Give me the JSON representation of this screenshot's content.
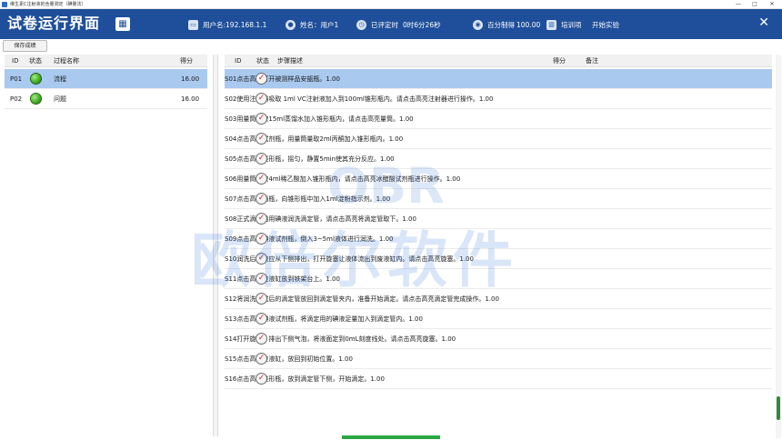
{
  "window": {
    "title": "维生素C注射液的含量测定（碘量法）",
    "controls": [
      "—",
      "□",
      "✕"
    ]
  },
  "header": {
    "app_title": "试卷运行界面",
    "username_label": "用户名:192.168.1.1",
    "name_label": "姓名：用户1",
    "timer_label": "已评定时",
    "timer_value": "0时6分26秒",
    "score_label": "百分制得",
    "score_value": "100.00",
    "mode_label": "培训项",
    "start_label": "开始实验",
    "close_icon": "✕"
  },
  "toolbar": {
    "save_label": "保存成绩"
  },
  "left_table": {
    "columns": [
      "ID",
      "状态",
      "过程名称",
      "得分"
    ],
    "rows": [
      {
        "id": "P01",
        "name": "流程",
        "score": "16.00",
        "selected": true
      },
      {
        "id": "P02",
        "name": "问题",
        "score": "16.00",
        "selected": false
      }
    ]
  },
  "right_table": {
    "columns": [
      "ID",
      "状态",
      "步骤描述",
      "得分",
      "备注"
    ],
    "rows": [
      {
        "id": "S01",
        "desc": "点击高亮打开被测样品安瓿瓶。",
        "score": "1.00",
        "note": "",
        "selected": true
      },
      {
        "id": "S02",
        "desc": "使用注射器吸取 1ml VC注射液加入到100ml锥形瓶内。请点击高亮注射器进行操作。",
        "score": "1.00",
        "note": ""
      },
      {
        "id": "S03",
        "desc": "用量筒量取15ml蒸馏水加入锥形瓶内，请点击高亮量筒。",
        "score": "1.00",
        "note": ""
      },
      {
        "id": "S04",
        "desc": "点击高亮试剂瓶，用量筒量取2ml丙酮加入锥形瓶内。",
        "score": "1.00",
        "note": ""
      },
      {
        "id": "S05",
        "desc": "点击高亮锥形瓶，摇匀，静置5min使其充分反应。",
        "score": "1.00",
        "note": ""
      },
      {
        "id": "S06",
        "desc": "用量筒量取4ml稀乙酸加入锥形瓶内，请点击高亮冰醋酸试剂瓶进行操作。",
        "score": "1.00",
        "note": ""
      },
      {
        "id": "S07",
        "desc": "点击高亮滴瓶，向锥形瓶中加入1ml淀粉指示剂。",
        "score": "1.00",
        "note": ""
      },
      {
        "id": "S08",
        "desc": "正式滴定前用碘液润洗滴定管，请点击高亮将滴定管取下。",
        "score": "1.00",
        "note": ""
      },
      {
        "id": "S09",
        "desc": "点击高亮碘液试剂瓶，倒入3~5ml液体进行润洗。",
        "score": "1.00",
        "note": ""
      },
      {
        "id": "S10",
        "desc": "润洗后碘液应从下侧排出，打开旋塞让液体流出到废液缸内。请点击高亮旋塞。",
        "score": "1.00",
        "note": ""
      },
      {
        "id": "S11",
        "desc": "点击高亮废液缸放到铁架台上。",
        "score": "1.00",
        "note": ""
      },
      {
        "id": "S12",
        "desc": "将润洗完成后的滴定管放回到滴定管夹内，准备开始滴定。请点击高亮滴定管完成操作。",
        "score": "1.00",
        "note": ""
      },
      {
        "id": "S13",
        "desc": "点击高亮碘液试剂瓶，将滴定用的碘液足量加入到滴定管内。",
        "score": "1.00",
        "note": ""
      },
      {
        "id": "S14",
        "desc": "打开旋塞，排出下侧气泡，将液面定到0mL刻度线处。请点击高亮旋塞。",
        "score": "1.00",
        "note": ""
      },
      {
        "id": "S15",
        "desc": "点击高亮废液缸，放回到初始位置。",
        "score": "1.00",
        "note": ""
      },
      {
        "id": "S16",
        "desc": "点击高亮锥形瓶，放到滴定管下侧，开始滴定。",
        "score": "1.00",
        "note": ""
      }
    ]
  },
  "watermark": {
    "logo": "OBR",
    "text": "欧倍尔软件"
  },
  "colors": {
    "header_bg": "#1f4f9a",
    "selected_row": "#a9c9ef",
    "status_green": "#2e9a15",
    "check_red": "#c42a2a"
  },
  "icons": {
    "app": "app-icon",
    "badge": "grid-icon",
    "user": "computer-icon",
    "person": "person-icon",
    "clock": "clock-icon",
    "score": "score-icon",
    "chart": "chart-icon",
    "status_ok": "green-dot-icon",
    "step_done": "check-circle-icon"
  }
}
